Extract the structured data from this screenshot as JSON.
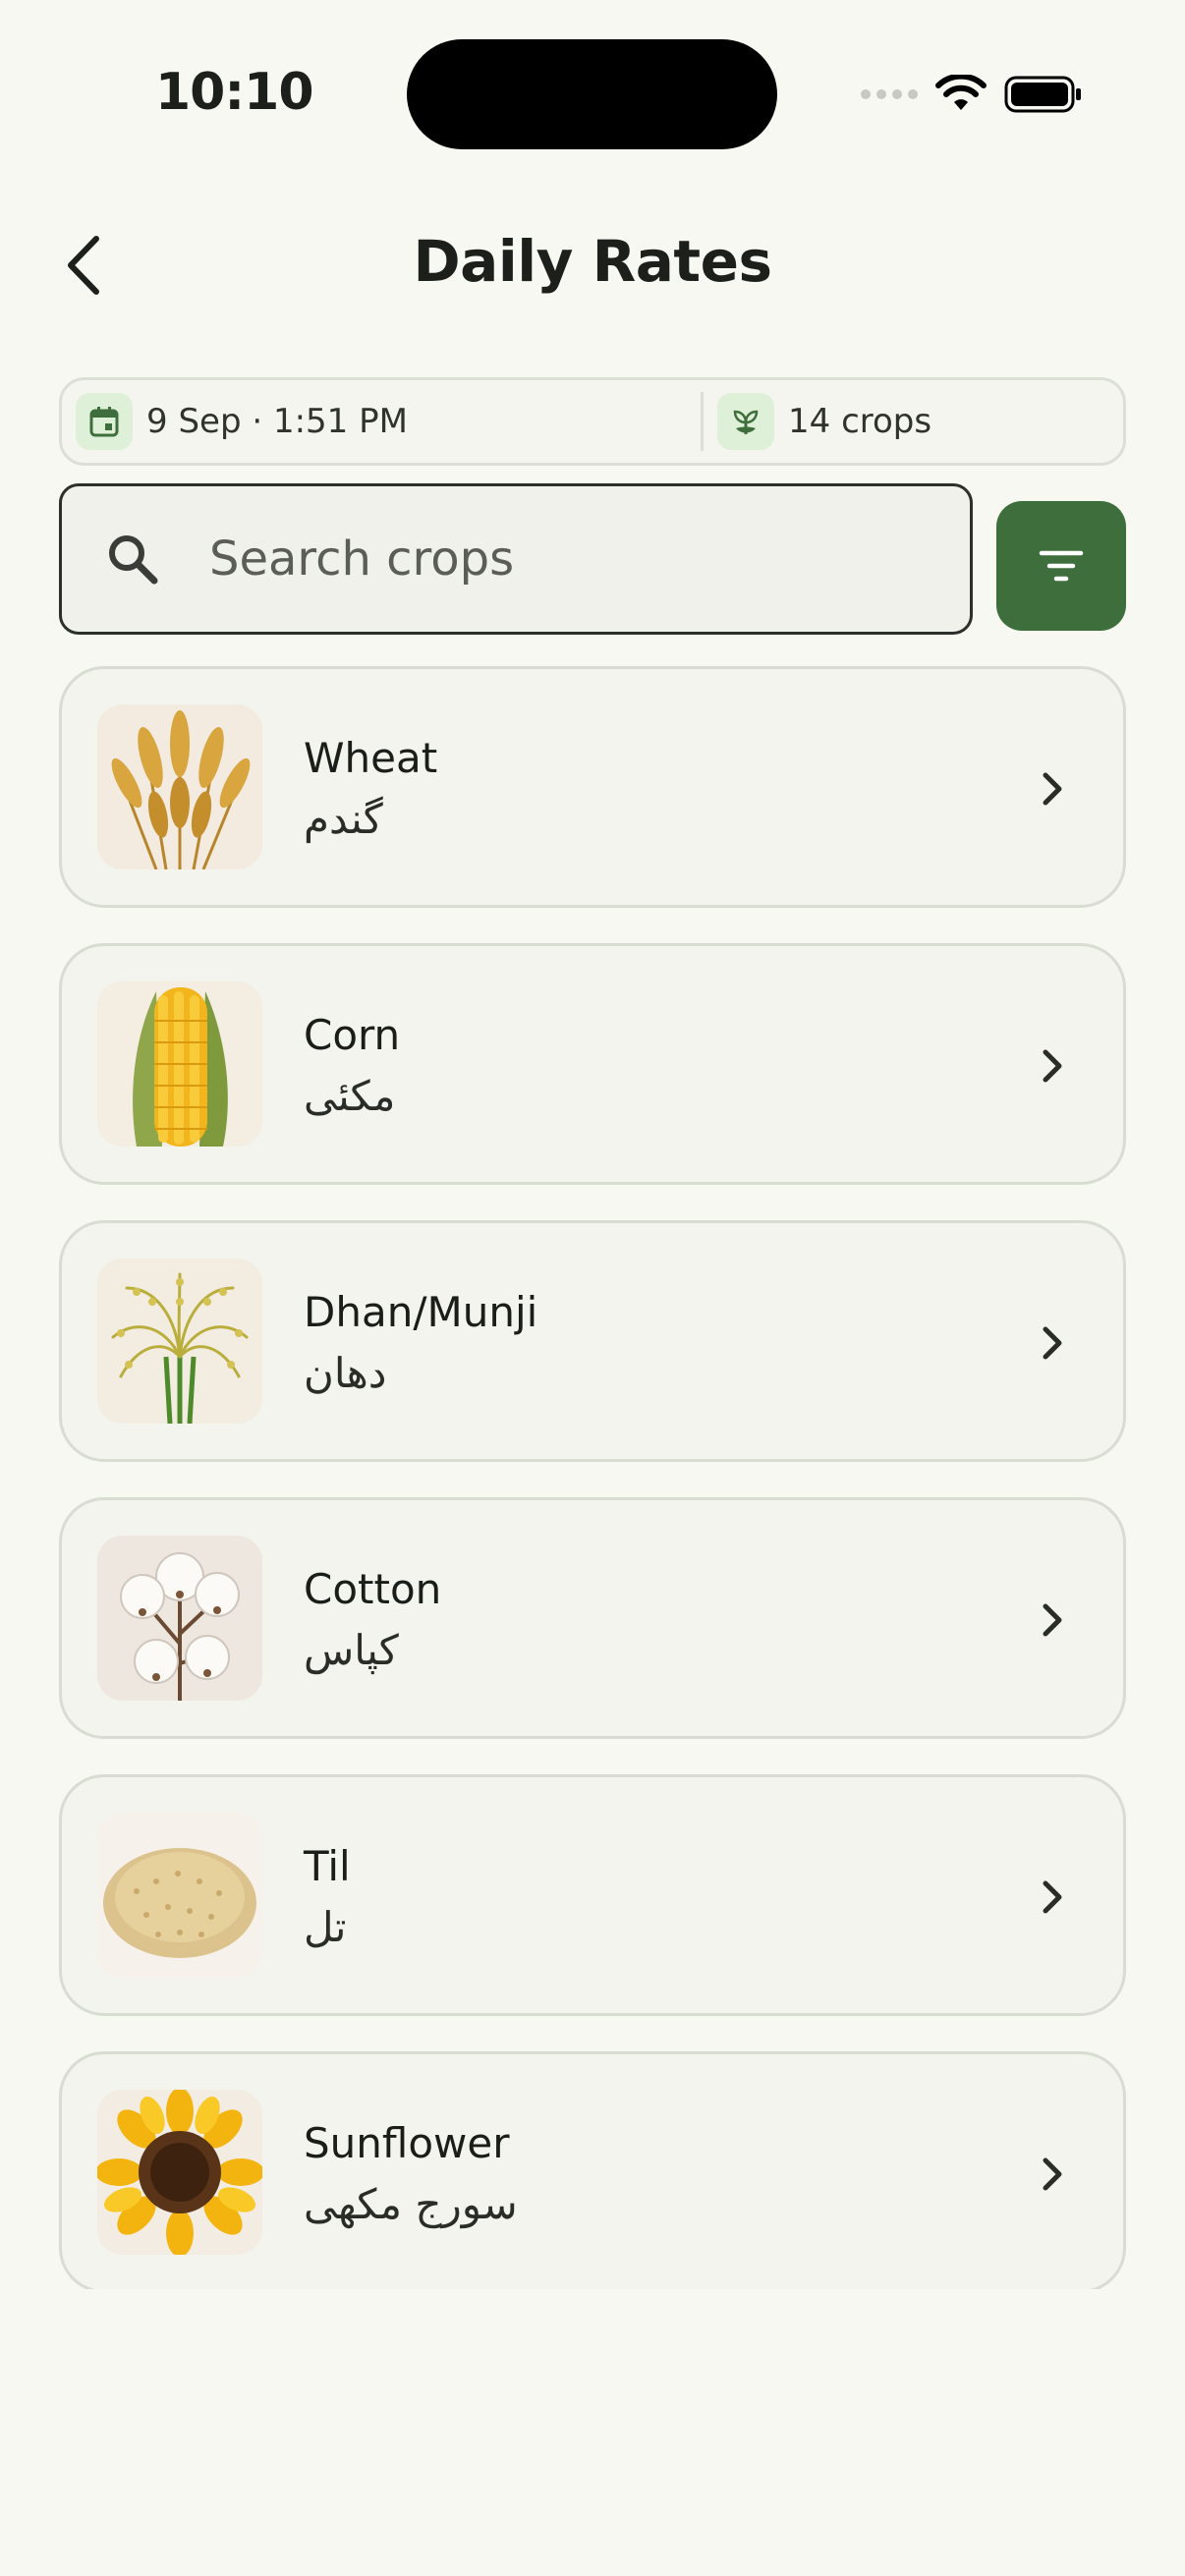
{
  "status": {
    "time": "10:10"
  },
  "header": {
    "title": "Daily Rates"
  },
  "info": {
    "date_time": "9 Sep · 1:51 PM",
    "crop_count": "14 crops"
  },
  "search": {
    "placeholder": "Search crops",
    "value": ""
  },
  "icons": {
    "back": "chevron-left-icon",
    "calendar": "calendar-icon",
    "sprout": "sprout-icon",
    "search": "search-icon",
    "filter": "filter-icon",
    "row_arrow": "chevron-right-icon"
  },
  "colors": {
    "accent": "#3e6e3b",
    "background": "#f6f8f1",
    "card": "#f2f4ed",
    "info_icon_bg": "#dff0d8"
  },
  "crops": [
    {
      "name": "Wheat",
      "urdu": "گندم",
      "thumb": "wheat"
    },
    {
      "name": "Corn",
      "urdu": "مکئی",
      "thumb": "corn"
    },
    {
      "name": "Dhan/Munji",
      "urdu": "دھان",
      "thumb": "rice"
    },
    {
      "name": "Cotton",
      "urdu": "کپاس",
      "thumb": "cotton"
    },
    {
      "name": "Til",
      "urdu": "تل",
      "thumb": "sesame"
    },
    {
      "name": "Sunflower",
      "urdu": "سورج مکھی",
      "thumb": "sunflower"
    }
  ]
}
